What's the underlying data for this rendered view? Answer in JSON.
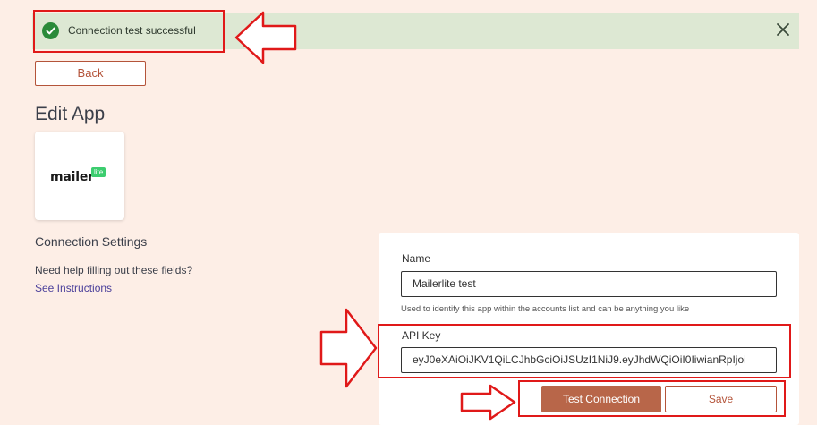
{
  "alert": {
    "message": "Connection test successful",
    "icon": "check-circle-icon",
    "close_icon": "close-icon"
  },
  "back_label": "Back",
  "page_title": "Edit App",
  "logo": {
    "text": "mailer",
    "badge": "lite"
  },
  "connection": {
    "title": "Connection Settings",
    "help_text": "Need help filling out these fields?",
    "help_link": "See Instructions"
  },
  "form": {
    "name_label": "Name",
    "name_value": "Mailerlite test",
    "name_hint": "Used to identify this app within the accounts list and can be anything you like",
    "api_key_label": "API Key",
    "api_key_value": "eyJ0eXAiOiJKV1QiLCJhbGciOiJSUzI1NiJ9.eyJhdWQiOiI0IiwianRpIjoi",
    "test_label": "Test Connection",
    "save_label": "Save"
  },
  "colors": {
    "background": "#fdeee6",
    "accent": "#b86649",
    "success_bg": "#dde8d3",
    "success_icon": "#2a8a3a",
    "annotation": "#e01919"
  }
}
